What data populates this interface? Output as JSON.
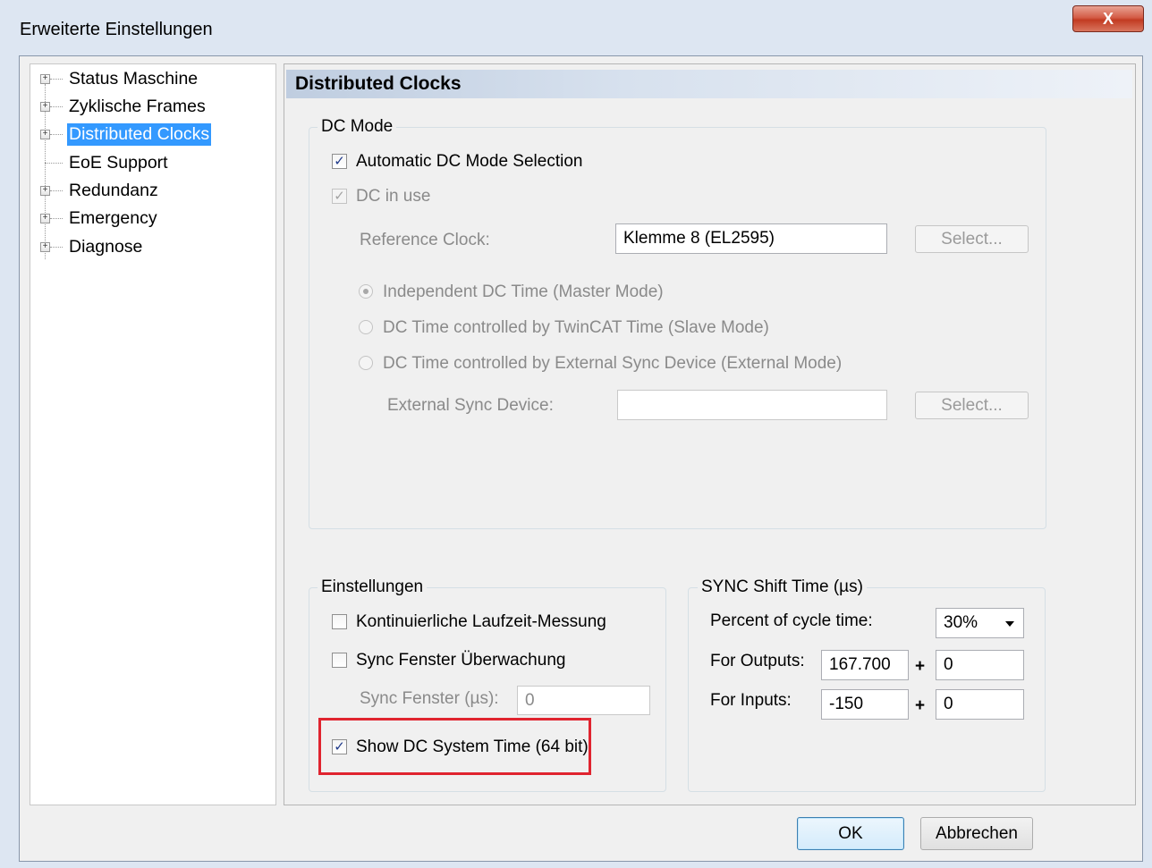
{
  "window": {
    "title": "Erweiterte Einstellungen",
    "close_label": "X"
  },
  "tree": {
    "items": [
      {
        "label": "Status Maschine",
        "expandable": true,
        "selected": false
      },
      {
        "label": "Zyklische Frames",
        "expandable": true,
        "selected": false
      },
      {
        "label": "Distributed Clocks",
        "expandable": true,
        "selected": true
      },
      {
        "label": "EoE Support",
        "expandable": false,
        "selected": false
      },
      {
        "label": "Redundanz",
        "expandable": true,
        "selected": false
      },
      {
        "label": "Emergency",
        "expandable": true,
        "selected": false
      },
      {
        "label": "Diagnose",
        "expandable": true,
        "selected": false
      }
    ]
  },
  "panel": {
    "header": "Distributed Clocks",
    "dc_mode": {
      "title": "DC Mode",
      "auto_select_label": "Automatic DC Mode Selection",
      "auto_select_checked": true,
      "dc_in_use_label": "DC in use",
      "dc_in_use_checked": true,
      "reference_clock_label": "Reference Clock:",
      "reference_clock_value": "Klemme 8 (EL2595)",
      "select_label": "Select...",
      "radio_independent": "Independent DC Time (Master Mode)",
      "radio_twincat": "DC Time controlled by TwinCAT Time (Slave Mode)",
      "radio_external": "DC Time controlled by External Sync Device (External Mode)",
      "external_sync_label": "External Sync Device:",
      "external_sync_value": "",
      "external_select_label": "Select..."
    },
    "settings": {
      "title": "Einstellungen",
      "continuous_label": "Kontinuierliche Laufzeit-Messung",
      "continuous_checked": false,
      "sync_window_label": "Sync Fenster Überwachung",
      "sync_window_checked": false,
      "sync_window_us_label": "Sync Fenster (µs):",
      "sync_window_us_value": "0",
      "show_dc_label": "Show DC System Time (64 bit)",
      "show_dc_checked": true
    },
    "sync_shift": {
      "title": "SYNC Shift Time (µs)",
      "percent_label": "Percent of cycle time:",
      "percent_value": "30%",
      "outputs_label": "For Outputs:",
      "outputs_value": "167.700",
      "outputs_offset": "0",
      "inputs_label": "For Inputs:",
      "inputs_value": "-150",
      "inputs_offset": "0",
      "plus": "+"
    }
  },
  "buttons": {
    "ok": "OK",
    "cancel": "Abbrechen"
  },
  "icons": {
    "check": "✓",
    "expander": "+"
  },
  "colors": {
    "selection": "#3399ff",
    "highlight_border": "#e0242f",
    "close_button": "#c23b22"
  }
}
